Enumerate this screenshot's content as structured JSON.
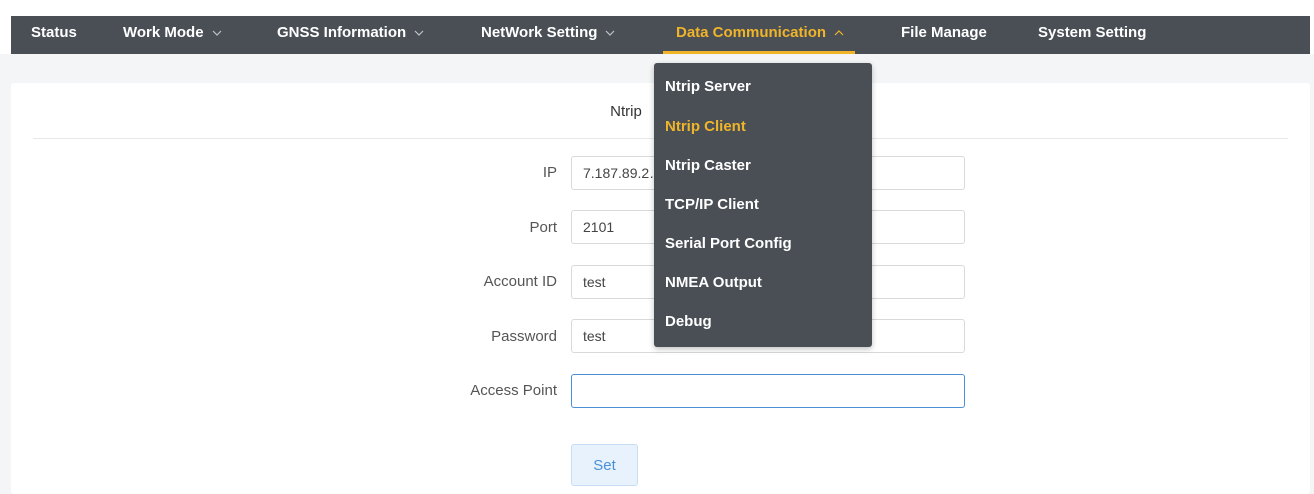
{
  "nav": {
    "items": [
      {
        "label": "Status",
        "has_chevron": false
      },
      {
        "label": "Work Mode",
        "has_chevron": true
      },
      {
        "label": "GNSS Information",
        "has_chevron": true
      },
      {
        "label": "NetWork Setting",
        "has_chevron": true
      },
      {
        "label": "Data Communication",
        "has_chevron": true,
        "active": true
      },
      {
        "label": "File Manage",
        "has_chevron": false
      },
      {
        "label": "System Setting",
        "has_chevron": false
      }
    ]
  },
  "dropdown": {
    "items": [
      {
        "label": "Ntrip Server"
      },
      {
        "label": "Ntrip Client",
        "active": true
      },
      {
        "label": "Ntrip Caster"
      },
      {
        "label": "TCP/IP Client"
      },
      {
        "label": "Serial Port Config"
      },
      {
        "label": "NMEA Output"
      },
      {
        "label": "Debug"
      }
    ]
  },
  "form": {
    "title": "Ntrip",
    "ip_label": "IP",
    "ip_value": "7.187.89.2…",
    "port_label": "Port",
    "port_value": "2101",
    "account_label": "Account ID",
    "account_value": "test",
    "password_label": "Password",
    "password_value": "test",
    "access_point_label": "Access Point",
    "access_point_value": "",
    "set_label": "Set"
  },
  "colors": {
    "navbar_bg": "#4a4f56",
    "accent": "#f0b429",
    "focus_border": "#4a90d9"
  }
}
